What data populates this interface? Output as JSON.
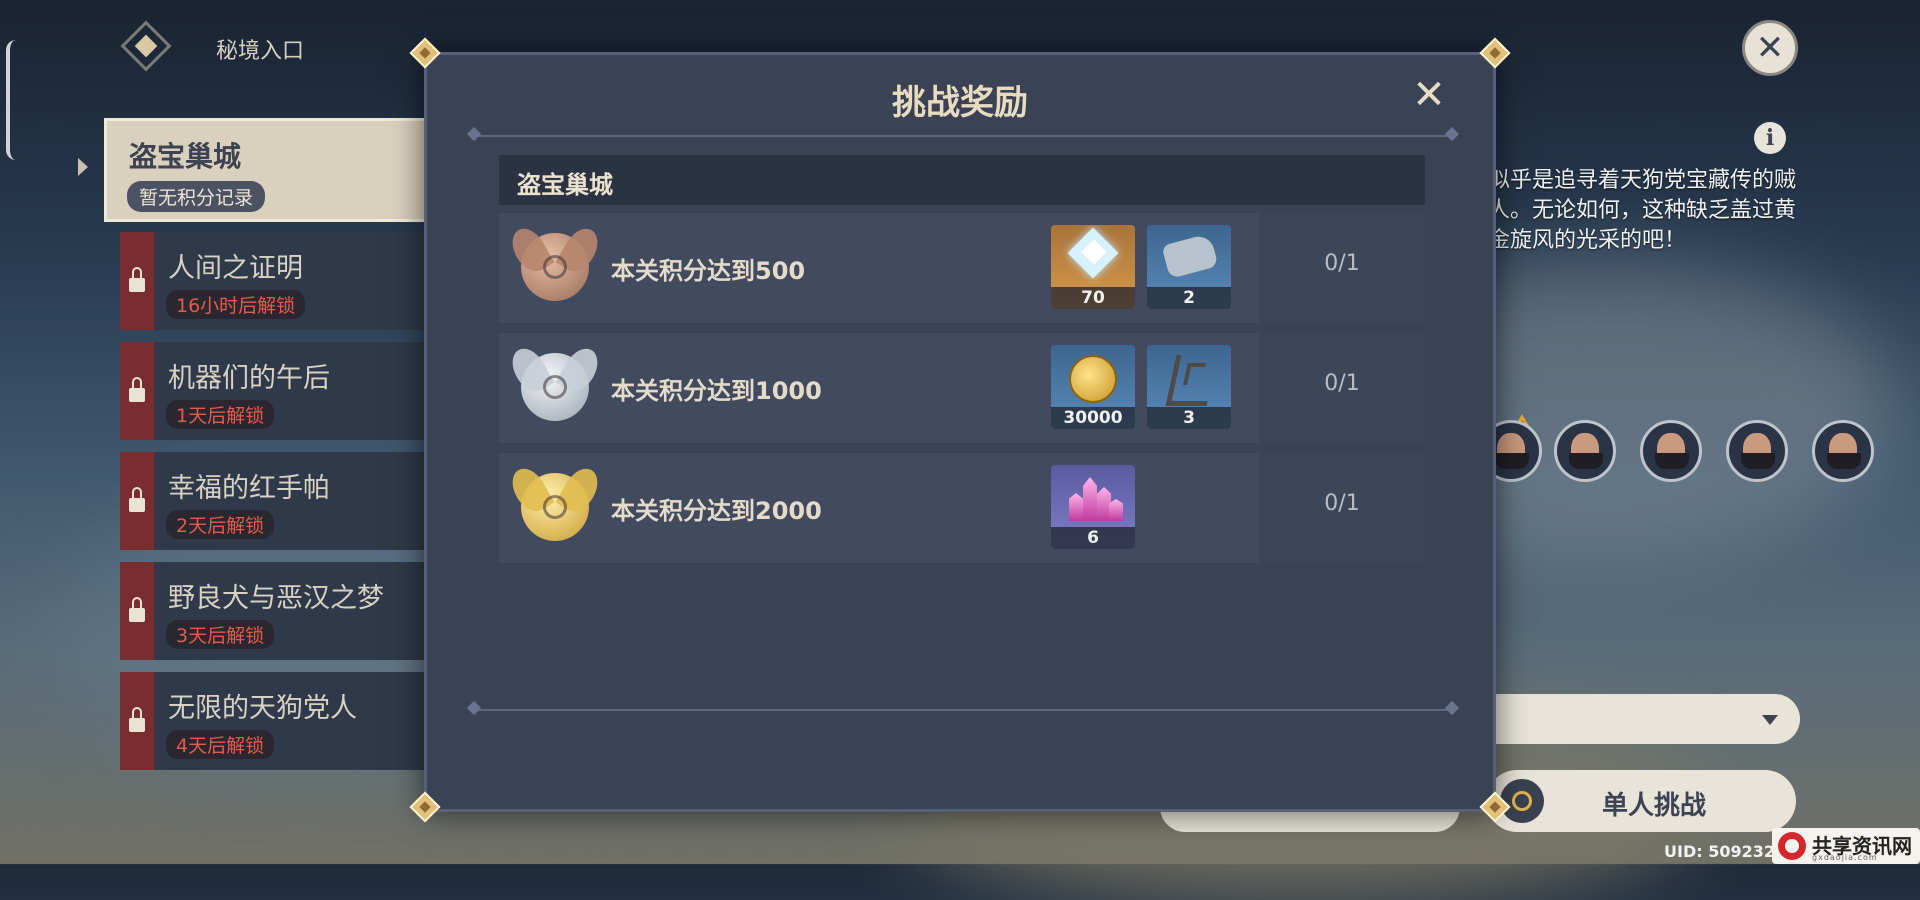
{
  "header": {
    "title": "秘境入口"
  },
  "domains": [
    {
      "name": "盗宝巢城",
      "status": "暂无积分记录",
      "active": true
    },
    {
      "name": "人间之证明",
      "status": "16小时后解锁",
      "locked": true
    },
    {
      "name": "机器们的午后",
      "status": "1天后解锁",
      "locked": true
    },
    {
      "name": "幸福的红手帕",
      "status": "2天后解锁",
      "locked": true
    },
    {
      "name": "野良犬与恶汉之梦",
      "status": "3天后解锁",
      "locked": true
    },
    {
      "name": "无限的天狗党人",
      "status": "4天后解锁",
      "locked": true
    }
  ],
  "description": "似乎是追寻着天狗党宝藏传的贼人。无论如何，这种缺乏盖过黄金旋风的光采的吧！",
  "modal": {
    "title": "挑战奖励",
    "section": "盗宝巢城",
    "rewards": [
      {
        "condition": "本关积分达到500",
        "items": [
          {
            "icon": "primogem-icon",
            "count": "70"
          },
          {
            "icon": "mora-kettle-icon",
            "count": "2"
          }
        ],
        "progress": "0/1",
        "tier": "bronze"
      },
      {
        "condition": "本关积分达到1000",
        "items": [
          {
            "icon": "mora-coin-icon",
            "count": "30000"
          },
          {
            "icon": "coral-branch-icon",
            "count": "3"
          }
        ],
        "progress": "0/1",
        "tier": "silver"
      },
      {
        "condition": "本关积分达到2000",
        "items": [
          {
            "icon": "crystal-icon",
            "count": "6"
          }
        ],
        "progress": "0/1",
        "tier": "gold"
      }
    ]
  },
  "buttons": {
    "solo": "单人挑战"
  },
  "footer": {
    "uid": "UID: 509232"
  },
  "watermark": {
    "text": "共享资讯网",
    "sub": "gxdaojia.com"
  },
  "colors": {
    "modal_bg": "#3b4256",
    "accent_gold": "#e8dcc0",
    "lock_red": "#7a2d2e",
    "unlock_text": "#e55a48"
  }
}
